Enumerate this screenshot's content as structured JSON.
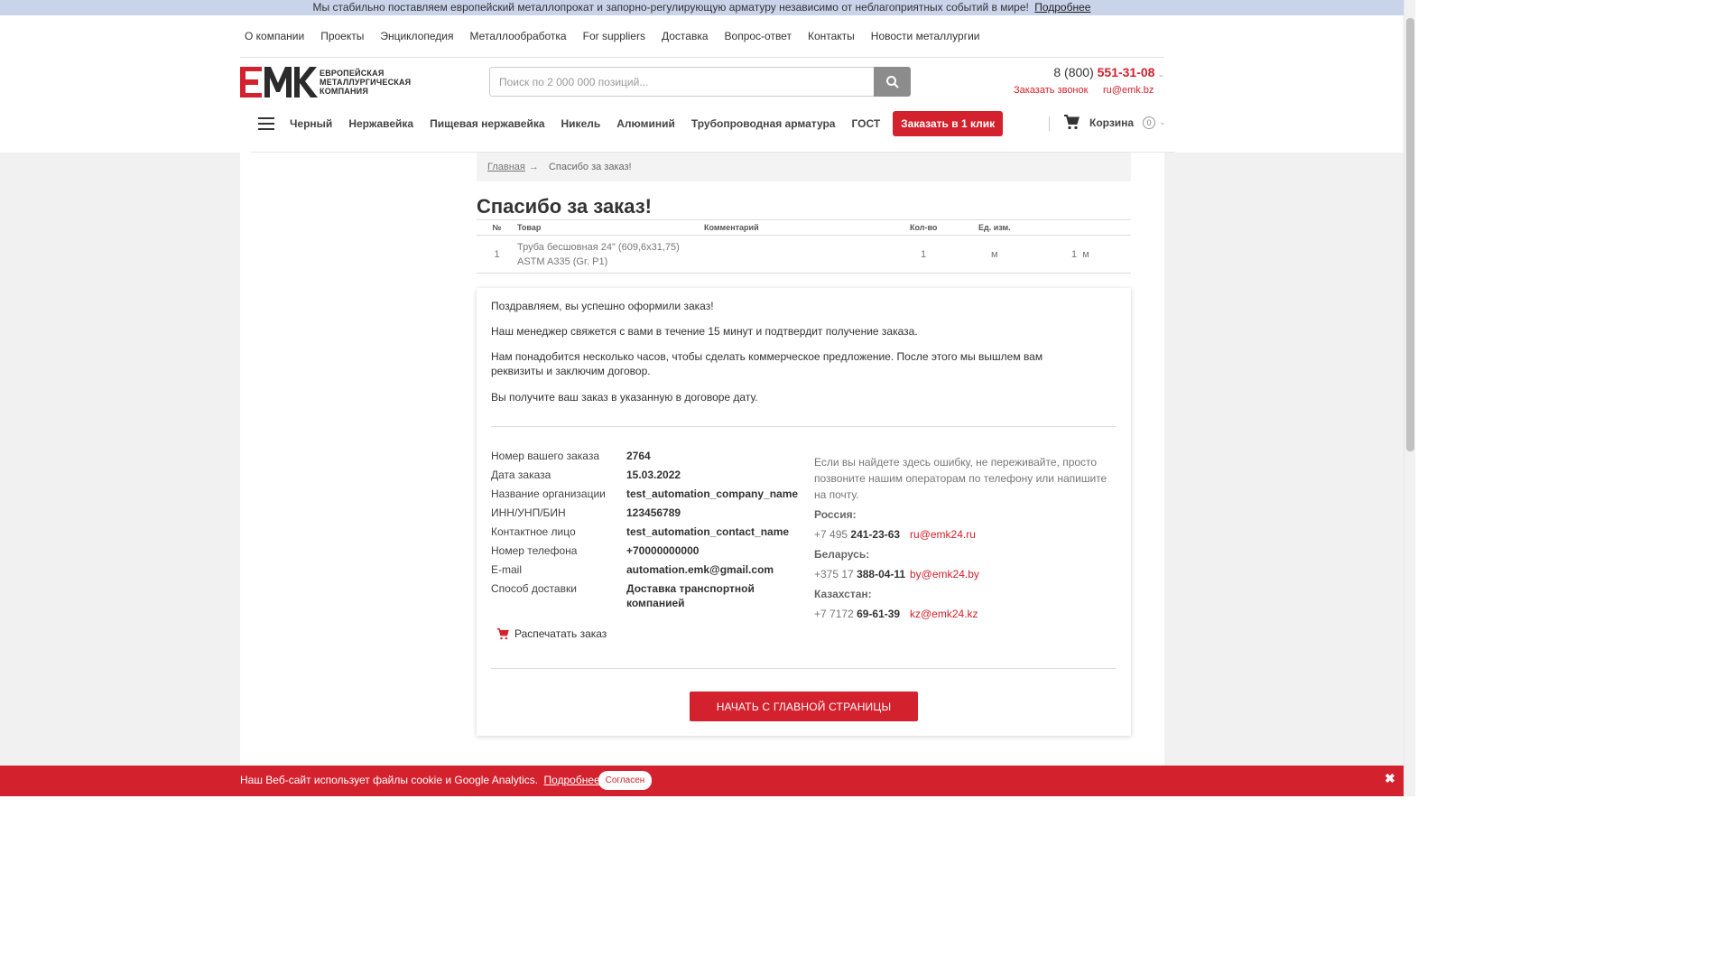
{
  "promo": {
    "text": "Мы стабильно поставляем европейский металлопрокат и запорно-регулирующую арматуру независимо от неблагоприятных событий в мире!",
    "link": "Подробнее"
  },
  "top_nav": [
    "О компании",
    "Проекты",
    "Энциклопедия",
    "Металлообработка",
    "For suppliers",
    "Доставка",
    "Вопрос-ответ",
    "Контакты",
    "Новости металлургии"
  ],
  "logo": {
    "line1": "ЕВРОПЕЙСКАЯ",
    "line2": "МЕТАЛЛУРГИЧЕСКАЯ",
    "line3": "КОМПАНИЯ"
  },
  "search": {
    "placeholder": "Поиск по 2 000 000 позиций..."
  },
  "contact_header": {
    "phone_prefix": "8 (800)",
    "phone_main": "551-31-08",
    "callback": "Заказать звонок",
    "email": "ru@emk.bz"
  },
  "categories": [
    "Черный",
    "Нержавейка",
    "Пищевая нержавейка",
    "Никель",
    "Алюминий",
    "Трубопроводная арматура",
    "ГОСТ"
  ],
  "quick_order": "Заказать в 1 клик",
  "cart": {
    "label": "Корзина",
    "count": "0"
  },
  "breadcrumb": {
    "home": "Главная",
    "arrow": "→",
    "current": "Спасибо за заказ!"
  },
  "title": "Спасибо за заказ!",
  "order_table": {
    "headers": [
      "№",
      "Товар",
      "Комментарий",
      "Кол-во",
      "Ед. изм."
    ],
    "row": {
      "num": "1",
      "product": "Труба бесшовная 24\" (609,6x31,75) ASTM A335 (Gr. P1)",
      "comment": "",
      "qty": "1",
      "unit": "м",
      "total_qty": "1",
      "total_unit": "м"
    }
  },
  "messages": [
    "Поздравляем, вы успешно оформили заказ!",
    "Наш менеджер свяжется с вами в течение 15 минут и подтвердит получение заказа.",
    "Нам понадобится несколько часов, чтобы сделать коммерческое предложение. После этого мы вышлем вам реквизиты и заключим договор.",
    "Вы получите ваш заказ в указанную в договоре дату."
  ],
  "details": [
    {
      "label": "Номер вашего заказа",
      "value": "2764"
    },
    {
      "label": "Дата заказа",
      "value": "15.03.2022"
    },
    {
      "label": "Название организации",
      "value": "test_automation_company_name"
    },
    {
      "label": "ИНН/УНП/БИН",
      "value": "123456789"
    },
    {
      "label": "Контактное лицо",
      "value": "test_automation_contact_name"
    },
    {
      "label": "Номер телефона",
      "value": "+70000000000"
    },
    {
      "label": "E-mail",
      "value": "automation.emk@gmail.com"
    },
    {
      "label": "Способ доставки",
      "value": "Доставка транспортной компанией"
    }
  ],
  "print_label": "Распечатать заказ",
  "contacts": {
    "note": "Если вы найдете здесь ошибку, не переживайте, просто позвоните нашим операторам по телефону или напишите на почту.",
    "regions": [
      {
        "country": "Россия:",
        "code": "+7 495",
        "number": "241-23-63",
        "email": "ru@emk24.ru"
      },
      {
        "country": "Беларусь:",
        "code": "+375 17",
        "number": "388-04-11",
        "email": "by@emk24.by"
      },
      {
        "country": "Казахстан:",
        "code": "+7 7172",
        "number": "69-61-39",
        "email": "kz@emk24.kz"
      }
    ]
  },
  "home_button": "НАЧАТЬ С ГЛАВНОЙ СТРАНИЦЫ",
  "cookie": {
    "text": "Наш Веб-сайт использует файлы cookie и Google Analytics.",
    "link": "Подробнее",
    "agree": "Согласен",
    "close": "✖"
  },
  "colors": {
    "accent": "#d3212d",
    "promo_bg": "#c9d3ea",
    "search_button": "#8c8c8c"
  }
}
